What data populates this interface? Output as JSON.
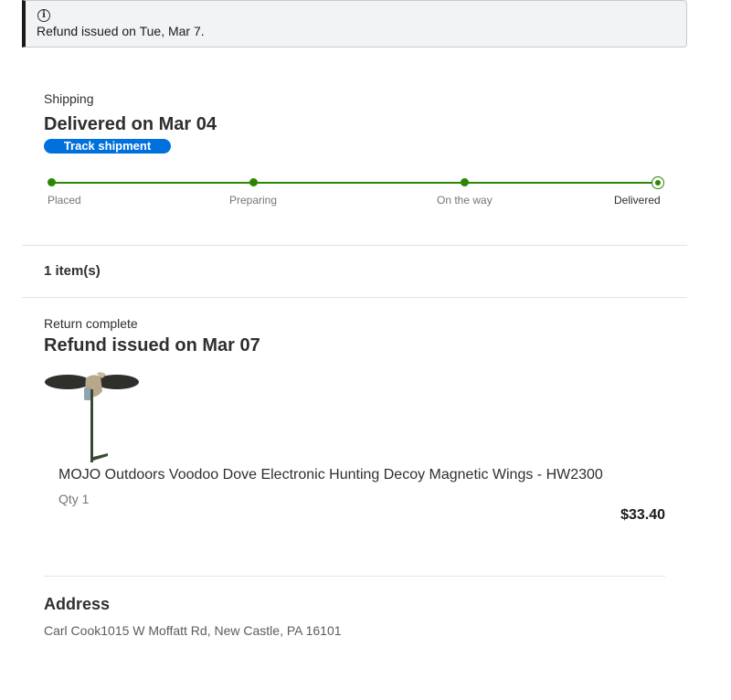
{
  "alert": {
    "icon": "info-icon",
    "message": "Refund issued on Tue, Mar 7."
  },
  "shipping": {
    "label": "Shipping",
    "title": "Delivered on Mar 04",
    "track_button": "Track shipment",
    "steps": [
      {
        "label": "Placed"
      },
      {
        "label": "Preparing"
      },
      {
        "label": "On the way"
      },
      {
        "label": "Delivered",
        "current": true
      }
    ],
    "accent_color": "#2a8703"
  },
  "items": {
    "count_label": "1 item(s)"
  },
  "return": {
    "status_label": "Return complete",
    "title": "Refund issued on Mar 07"
  },
  "product": {
    "name": "MOJO Outdoors Voodoo Dove Electronic Hunting Decoy Magnetic Wings - HW2300",
    "qty": "Qty 1",
    "price": "$33.40"
  },
  "address": {
    "title": "Address",
    "text": "Carl Cook1015 W Moffatt Rd, New Castle, PA 16101"
  },
  "colors": {
    "button_blue": "#0071dc",
    "progress_green": "#2a8703"
  }
}
